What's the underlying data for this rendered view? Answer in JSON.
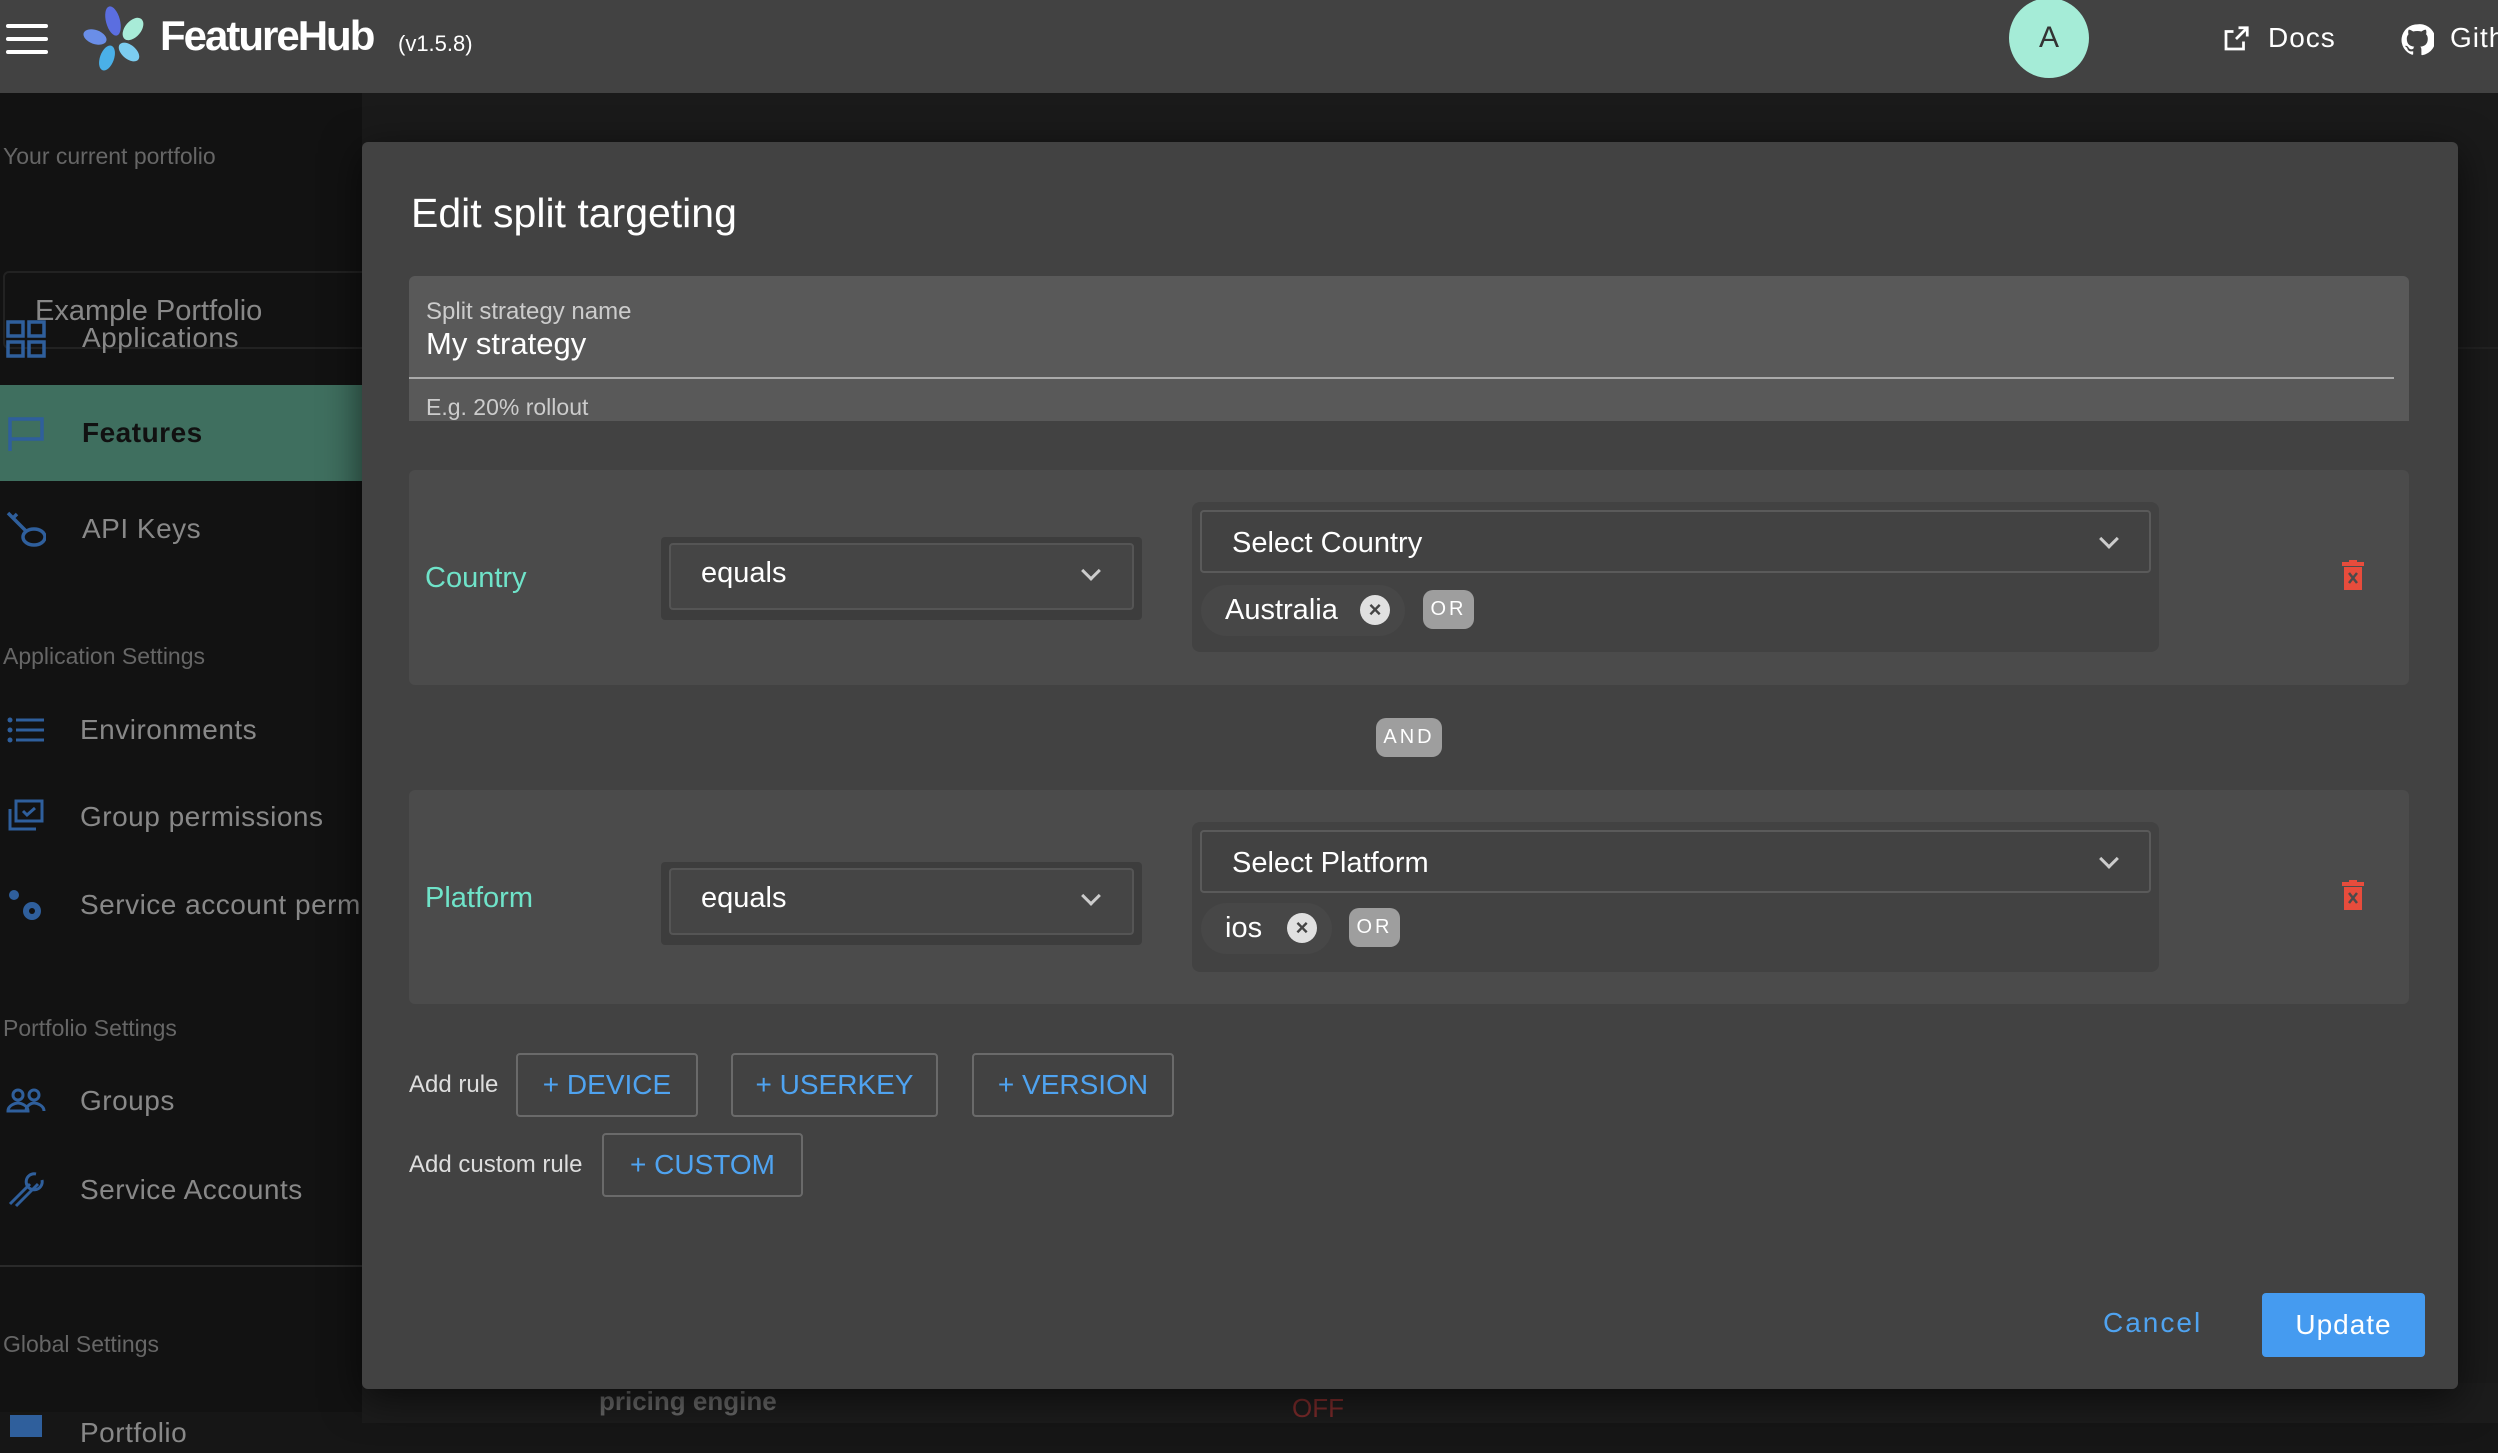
{
  "header": {
    "brand": "FeatureHub",
    "version": "(v1.5.8)",
    "avatar_initial": "A",
    "docs_label": "Docs",
    "github_label": "Gith"
  },
  "sidebar": {
    "portfolio_label": "Your current portfolio",
    "portfolio_value": "Example Portfolio",
    "items": [
      {
        "label": "Applications",
        "icon": "grid-icon"
      },
      {
        "label": "Features",
        "icon": "flag-icon",
        "active": true
      },
      {
        "label": "API Keys",
        "icon": "key-icon"
      }
    ],
    "app_settings_label": "Application Settings",
    "app_settings": [
      {
        "label": "Environments",
        "icon": "list-icon"
      },
      {
        "label": "Group permissions",
        "icon": "checklist-icon"
      },
      {
        "label": "Service account permi",
        "icon": "gears-icon"
      }
    ],
    "portfolio_settings_label": "Portfolio Settings",
    "portfolio_settings": [
      {
        "label": "Groups",
        "icon": "people-icon"
      },
      {
        "label": "Service Accounts",
        "icon": "wrench-icon"
      }
    ],
    "global_settings_label": "Global Settings",
    "global_settings": [
      {
        "label": "Portfolio",
        "icon": "briefcase-icon"
      }
    ]
  },
  "background": {
    "feature_name": "pricing engine",
    "status": "OFF"
  },
  "modal": {
    "title": "Edit split targeting",
    "name_field": {
      "label": "Split strategy name",
      "value": "My strategy",
      "helper": "E.g. 20% rollout"
    },
    "rules": [
      {
        "label": "Country",
        "operator": "equals",
        "select_placeholder": "Select Country",
        "values": [
          "Australia"
        ],
        "or_label": "OR"
      },
      {
        "label": "Platform",
        "operator": "equals",
        "select_placeholder": "Select Platform",
        "values": [
          "ios"
        ],
        "or_label": "OR"
      }
    ],
    "and_label": "AND",
    "add_rule_label": "Add rule",
    "add_rule_buttons": [
      "+ DEVICE",
      "+ USERKEY",
      "+ VERSION"
    ],
    "add_custom_label": "Add custom rule",
    "custom_button": "+ CUSTOM",
    "cancel": "Cancel",
    "update": "Update"
  },
  "colors": {
    "accent": "#459bf0",
    "rule_label": "#6fe3c9",
    "delete": "#e74c3c",
    "avatar": "#a5ecd7",
    "active_nav": "#3f6f5f"
  }
}
